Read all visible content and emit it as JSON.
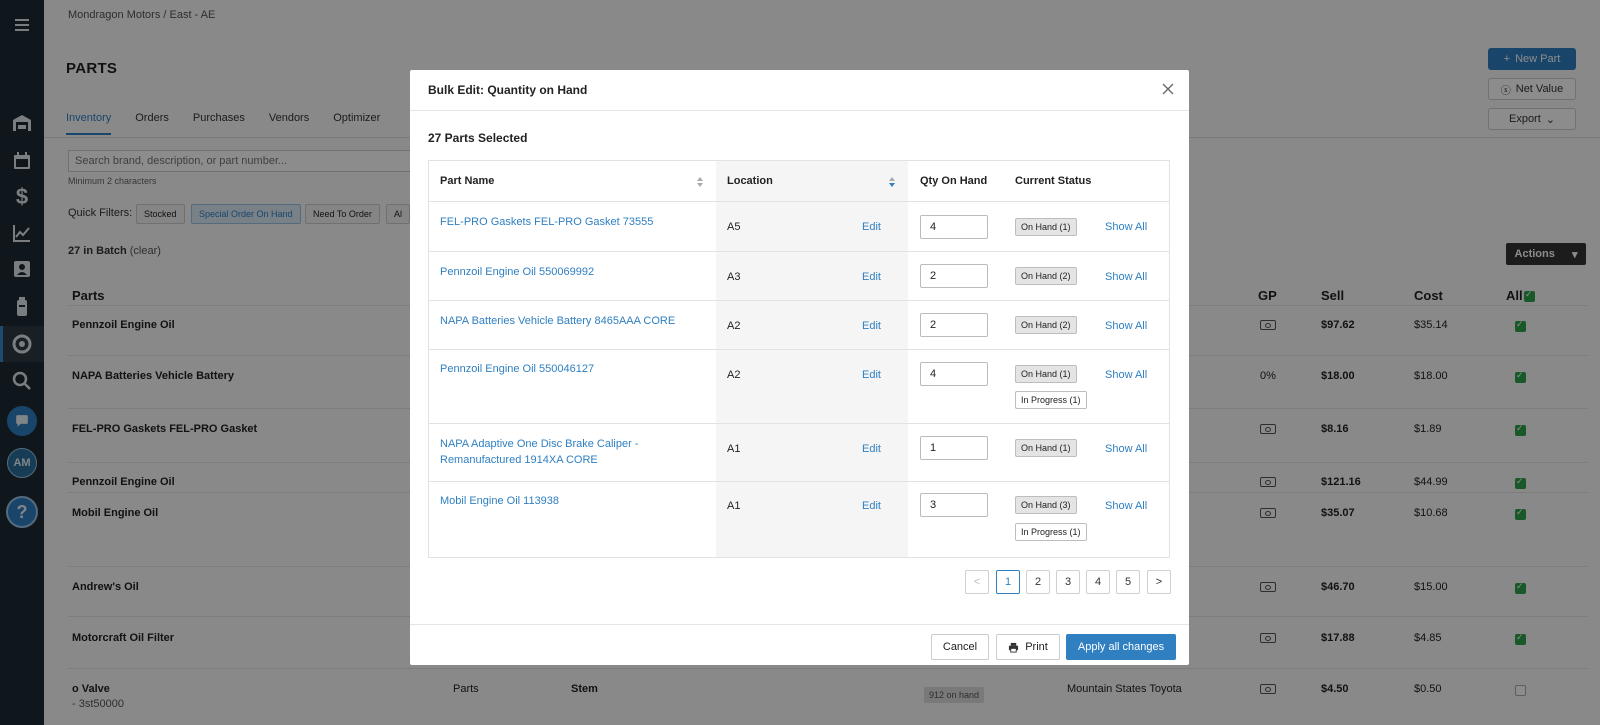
{
  "breadcrumb": "Mondragon Motors / East - AE",
  "page_title": "PARTS",
  "tabs": [
    "Inventory",
    "Orders",
    "Purchases",
    "Vendors",
    "Optimizer"
  ],
  "header_buttons": {
    "new_part": "New Part",
    "net_value": "Net Value",
    "export": "Export"
  },
  "search": {
    "placeholder": "Search brand, description, or part number...",
    "hint": "Minimum 2 characters"
  },
  "quick_filters": {
    "label": "Quick Filters:",
    "chips": [
      "Stocked",
      "Special Order On Hand",
      "Need To Order",
      "Al"
    ]
  },
  "batch": {
    "count": "27 in Batch",
    "clear": "(clear)"
  },
  "actions_label": "Actions",
  "table": {
    "headers": {
      "parts": "Parts",
      "gp": "GP",
      "sell": "Sell",
      "cost": "Cost",
      "all": "All"
    },
    "rows": [
      {
        "name": "Pennzoil Engine Oil",
        "sub": "",
        "gp": "",
        "sell": "$97.62",
        "cost": "$35.14",
        "checked": true
      },
      {
        "name": "NAPA Batteries Vehicle Battery",
        "sub": "",
        "gp": "0%",
        "sell": "$18.00",
        "cost": "$18.00",
        "checked": true
      },
      {
        "name": "FEL-PRO Gaskets FEL-PRO Gasket",
        "sub": "",
        "gp": "",
        "sell": "$8.16",
        "cost": "$1.89",
        "checked": true
      },
      {
        "name": "Pennzoil Engine Oil",
        "sub": "",
        "gp": "",
        "sell": "$121.16",
        "cost": "$44.99",
        "checked": true
      },
      {
        "name": "Mobil Engine Oil",
        "sub": "",
        "gp": "",
        "sell": "$35.07",
        "cost": "$10.68",
        "checked": true
      },
      {
        "name": "Andrew's Oil",
        "sub": "",
        "gp": "",
        "sell": "$46.70",
        "cost": "$15.00",
        "checked": true
      },
      {
        "name": "Motorcraft Oil Filter",
        "sub": "",
        "gp": "",
        "sell": "$17.88",
        "cost": "$4.85",
        "checked": true
      },
      {
        "name": "o Valve",
        "sub": "- 3st50000",
        "gp": "",
        "sell": "$4.50",
        "cost": "$0.50",
        "checked": false,
        "type": "Parts",
        "stem": "Stem",
        "onhand": "912 on hand",
        "vendor": "Mountain States Toyota"
      }
    ]
  },
  "modal": {
    "title": "Bulk Edit: Quantity on Hand",
    "selected": "27 Parts Selected",
    "headers": {
      "part_name": "Part Name",
      "location": "Location",
      "qty": "Qty On Hand",
      "status": "Current Status"
    },
    "edit_label": "Edit",
    "show_all_label": "Show All",
    "rows": [
      {
        "part": "FEL-PRO Gaskets FEL-PRO Gasket 73555",
        "location": "A5",
        "qty": "4",
        "statuses": [
          "On Hand (1)"
        ]
      },
      {
        "part": "Pennzoil Engine Oil 550069992",
        "location": "A3",
        "qty": "2",
        "statuses": [
          "On Hand (2)"
        ]
      },
      {
        "part": "NAPA Batteries Vehicle Battery 8465AAA CORE",
        "location": "A2",
        "qty": "2",
        "statuses": [
          "On Hand (2)"
        ]
      },
      {
        "part": "Pennzoil Engine Oil 550046127",
        "location": "A2",
        "qty": "4",
        "statuses": [
          "On Hand (1)",
          "In Progress (1)"
        ]
      },
      {
        "part": "NAPA Adaptive One Disc Brake Caliper - Remanufactured 1914XA CORE",
        "location": "A1",
        "qty": "1",
        "statuses": [
          "On Hand (1)"
        ]
      },
      {
        "part": "Mobil Engine Oil 113938",
        "location": "A1",
        "qty": "3",
        "statuses": [
          "On Hand (3)",
          "In Progress (1)"
        ]
      }
    ],
    "pagination": {
      "prev": "<",
      "pages": [
        "1",
        "2",
        "3",
        "4",
        "5"
      ],
      "next": ">",
      "current": "1"
    },
    "footer": {
      "cancel": "Cancel",
      "print": "Print",
      "apply": "Apply all changes"
    }
  },
  "sidebar": {
    "icons": [
      "menu-icon",
      "garage-icon",
      "calendar-icon",
      "dollar-icon",
      "chart-icon",
      "contacts-icon",
      "oil-icon",
      "parts-icon",
      "search-icon",
      "chat-icon",
      "avatar",
      "help-icon"
    ],
    "avatar_initials": "AM",
    "help_symbol": "?"
  },
  "colors": {
    "accent": "#2f7fc1",
    "sidebar": "#1e2a33",
    "check_green": "#2fa24b"
  }
}
